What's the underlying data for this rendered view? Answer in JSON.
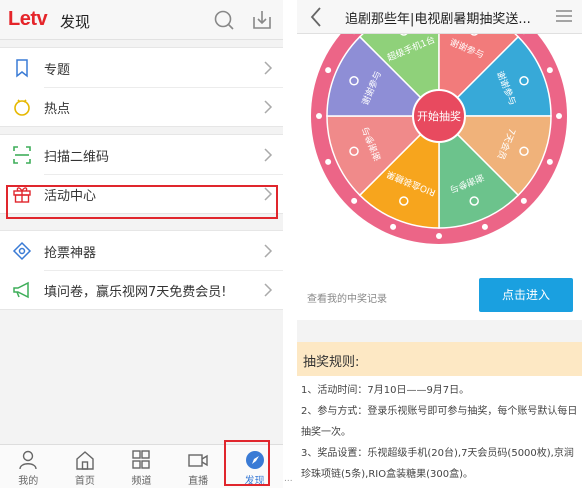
{
  "left": {
    "logo": "Letv",
    "title": "发现",
    "menu_groups": [
      [
        {
          "label": "专题"
        },
        {
          "label": "热点"
        }
      ],
      [
        {
          "label": "扫描二维码"
        },
        {
          "label": "活动中心"
        }
      ],
      [
        {
          "label": "抢票神器"
        },
        {
          "label": "填问卷，赢乐视网7天免费会员!"
        }
      ]
    ],
    "tabs": [
      {
        "label": "我的",
        "icon": "person-icon"
      },
      {
        "label": "首页",
        "icon": "home-icon"
      },
      {
        "label": "频道",
        "icon": "grid-icon"
      },
      {
        "label": "直播",
        "icon": "video-camera-icon"
      },
      {
        "label": "发现",
        "icon": "compass-icon",
        "active": true
      }
    ]
  },
  "right": {
    "title": "追剧那些年|电视剧暑期抽奖送...",
    "wheel": {
      "center_label": "开始抽奖",
      "segments": [
        {
          "label": "超级手机1台",
          "color": "#8fd17a"
        },
        {
          "label": "谢谢参与",
          "color": "#f27b7b"
        },
        {
          "label": "谢谢参与",
          "color": "#37a9d8"
        },
        {
          "label": "7天会员",
          "color": "#f0b27a"
        },
        {
          "label": "谢谢参与",
          "color": "#6cc38c"
        },
        {
          "label": "RIO盒装糖果",
          "color": "#f7a51d"
        },
        {
          "label": "谢谢参与",
          "color": "#f08a8a"
        },
        {
          "label": "谢谢参与",
          "color": "#8e8ed6"
        }
      ],
      "rim_color": "#ec6587"
    },
    "record_link": "查看我的中奖记录",
    "join_button": "点击进入",
    "rules_title": "抽奖规则:",
    "rules": [
      "1、活动时间：7月10日——9月7日。",
      "2、参与方式：登录乐视账号即可参与抽奖，每个账号默认每日抽奖一次。",
      "3、奖品设置：乐视超级手机(20台),7天会员码(5000枚),京润珍珠项链(5条),RIO盒装糖果(300盒)。"
    ],
    "trailing": "..."
  },
  "colors": {
    "brand_red": "#e5252a",
    "accent_blue": "#1aa0e0",
    "highlight_red": "#e0262d"
  }
}
